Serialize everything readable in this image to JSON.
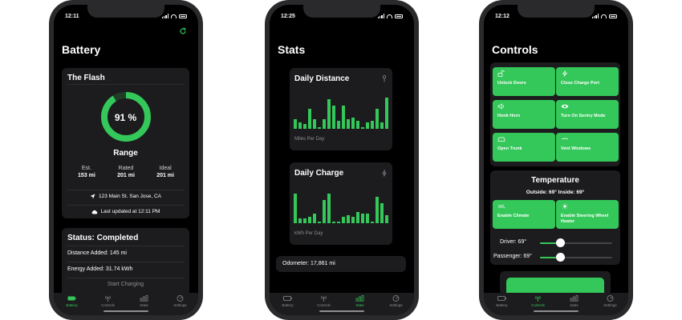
{
  "tabs": [
    "Battery",
    "Controls",
    "Stats",
    "Settings"
  ],
  "phone1": {
    "time": "12:11",
    "title": "Battery",
    "card_title": "The Flash",
    "gauge_label": "91 %",
    "gauge_level": 0.91,
    "range_title": "Range",
    "ranges": [
      {
        "label": "Est.",
        "value": "153 mi"
      },
      {
        "label": "Rated",
        "value": "201 mi"
      },
      {
        "label": "Ideal",
        "value": "201 mi"
      }
    ],
    "location": "123 Main St. San Jose, CA",
    "last_updated": "Last updated at 12:11 PM",
    "status_title": "Status: Completed",
    "distance_added": "Distance Added: 145 mi",
    "energy_added": "Energy Added: 31.74 kWh",
    "start_charging": "Start Charging"
  },
  "phone2": {
    "time": "12:25",
    "title": "Stats",
    "distance_title": "Daily Distance",
    "distance_caption": "Miles Per Day",
    "charge_title": "Daily Charge",
    "charge_caption": "kWh Per Day",
    "odometer": "Odometer: 17,861 mi",
    "distance_bars": [
      0.3,
      0.2,
      0.15,
      0.6,
      0.3,
      0.05,
      0.3,
      0.9,
      0.7,
      0.25,
      0.7,
      0.3,
      0.35,
      0.25,
      0.05,
      0.2,
      0.25,
      0.6,
      0.2,
      0.95
    ],
    "charge_bars": [
      0.9,
      0.15,
      0.15,
      0.2,
      0.3,
      0.05,
      0.7,
      0.9,
      0.05,
      0.05,
      0.2,
      0.25,
      0.2,
      0.35,
      0.3,
      0.3,
      0.05,
      0.8,
      0.6,
      0.25
    ]
  },
  "phone3": {
    "time": "12:12",
    "title": "Controls",
    "controls": [
      "Unlock Doors",
      "Close Charge Port",
      "Honk Horn",
      "Turn On Sentry Mode",
      "Open Trunk",
      "Vent Windows"
    ],
    "temp_title": "Temperature",
    "temp_readout": "Outside: 69° Inside: 69°",
    "climate": [
      "Enable Climate",
      "Enable Steering Wheel Heater"
    ],
    "driver": "Driver: 69°",
    "passenger": "Passenger: 69°"
  },
  "colors": {
    "accent": "#34c759",
    "card": "#1c1c1e",
    "background": "#000000"
  }
}
